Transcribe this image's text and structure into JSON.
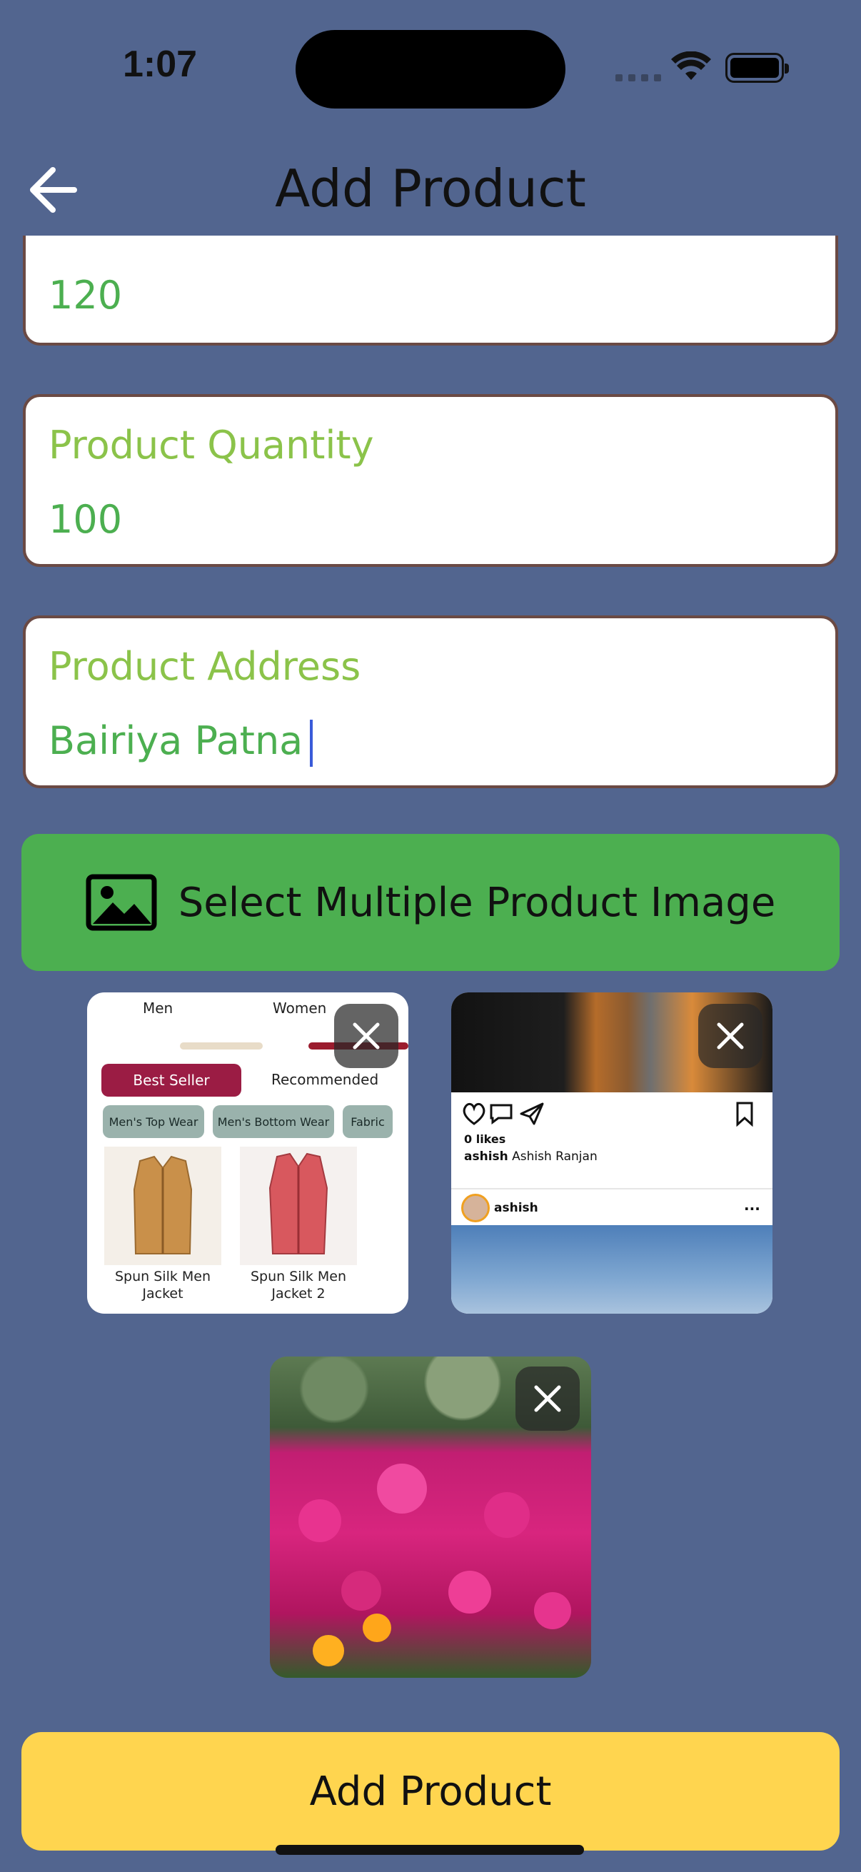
{
  "status_bar": {
    "time": "1:07"
  },
  "header": {
    "title": "Add Product"
  },
  "fields": {
    "price": {
      "value": "120"
    },
    "quantity": {
      "label": "Product Quantity",
      "value": "100"
    },
    "address": {
      "label": "Product Address",
      "value": "Bairiya Patna"
    }
  },
  "select_images_button": {
    "label": "Select Multiple Product Image"
  },
  "selected_images": {
    "shop_screenshot": {
      "categories": [
        "Men",
        "Women"
      ],
      "tabs": {
        "best_seller": "Best Seller",
        "recommended": "Recommended"
      },
      "chips": [
        "Men's Top Wear",
        "Men's Bottom Wear",
        "Fabric"
      ],
      "products": [
        {
          "name_line1": "Spun Silk Men",
          "name_line2": "Jacket"
        },
        {
          "name_line1": "Spun Silk Men",
          "name_line2": "Jacket 2"
        }
      ]
    },
    "social_screenshot": {
      "likes": "0 likes",
      "caption_user": "ashish",
      "caption_text": "Ashish Ranjan",
      "post_user": "ashish",
      "more": "..."
    }
  },
  "add_button": {
    "label": "Add Product"
  },
  "colors": {
    "background": "#52658f",
    "field_text": "#4caf50",
    "field_label": "#8bc34a",
    "select_button": "#4caf50",
    "add_button": "#ffd54f"
  }
}
